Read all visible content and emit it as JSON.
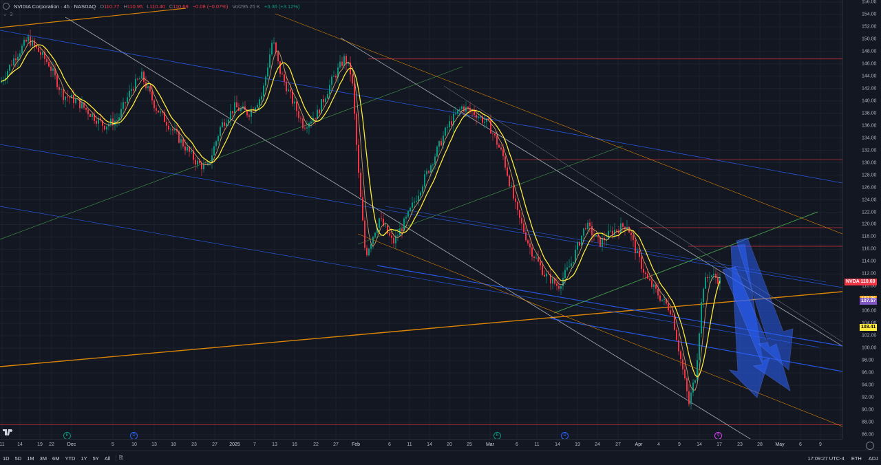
{
  "legend": {
    "symbol": "NVIDIA Corporation · 4h · NASDAQ",
    "o_label": "O",
    "o_val": "110.77",
    "h_label": "H",
    "h_val": "110.95",
    "l_label": "L",
    "l_val": "110.40",
    "c_label": "C",
    "c_val": "110.69",
    "change": "−0.08 (−0.07%)",
    "vol_label": "Vol",
    "vol_val": "295.25 K",
    "vol_change": "+3.36 (+3.12%)",
    "indicator_count": "3"
  },
  "price_axis": {
    "ticks": [
      "156.00",
      "154.00",
      "152.00",
      "150.00",
      "148.00",
      "146.00",
      "144.00",
      "142.00",
      "140.00",
      "138.00",
      "136.00",
      "134.00",
      "132.00",
      "130.00",
      "128.00",
      "126.00",
      "124.00",
      "122.00",
      "120.00",
      "118.00",
      "116.00",
      "114.00",
      "112.00",
      "110.00",
      "108.00",
      "106.00",
      "104.00",
      "102.00",
      "100.00",
      "98.00",
      "96.00",
      "94.00",
      "92.00",
      "90.00",
      "88.00",
      "86.00"
    ],
    "labels": [
      {
        "text": "NVDA",
        "value": "110.69",
        "bg": "#f23645",
        "fg": "#ffffff",
        "price": 110.69
      },
      {
        "text": "",
        "value": "107.96",
        "bg": "#ff9800",
        "fg": "#ffffff",
        "price": 107.96
      },
      {
        "text": "",
        "value": "107.57",
        "bg": "#7e57c2",
        "fg": "#ffffff",
        "price": 107.57
      },
      {
        "text": "",
        "value": "103.41",
        "bg": "#ffeb3b",
        "fg": "#000000",
        "price": 103.41
      }
    ]
  },
  "time_axis": {
    "ticks": [
      "11",
      "14",
      "19",
      "22",
      "Dec",
      "5",
      "10",
      "13",
      "18",
      "23",
      "27",
      "2025",
      "7",
      "13",
      "16",
      "22",
      "27",
      "Feb",
      "6",
      "11",
      "14",
      "20",
      "25",
      "Mar",
      "6",
      "11",
      "14",
      "19",
      "24",
      "27",
      "Apr",
      "4",
      "9",
      "14",
      "17",
      "23",
      "28",
      "May",
      "6",
      "9"
    ]
  },
  "bottom_bar": {
    "ranges": [
      "1D",
      "5D",
      "1M",
      "3M",
      "6M",
      "YTD",
      "1Y",
      "5Y",
      "All"
    ],
    "time": "17:09:27 UTC-4",
    "session": "ETH",
    "adj": "ADJ"
  },
  "events": [
    {
      "letter": "E",
      "kind": "earnings"
    },
    {
      "letter": "D",
      "kind": "dividend"
    },
    {
      "letter": "E",
      "kind": "earnings"
    },
    {
      "letter": "D",
      "kind": "dividend"
    }
  ],
  "colors": {
    "bg": "#131722",
    "up": "#089981",
    "down": "#f23645",
    "ma_fast": "#ffeb3b",
    "ma_slow": "#e3a86b",
    "trend_white": "#b2b5be",
    "trend_blue": "#2962ff",
    "trend_orange": "#ff9800",
    "trend_green": "#4caf50",
    "hline_red": "#f23645",
    "arrow_blue": "#2962ff"
  },
  "chart_data": {
    "type": "candlestick",
    "symbol": "NVDA",
    "interval": "4h",
    "ylim": [
      85,
      156
    ],
    "key_prices": [
      146.8,
      130.5,
      119.5,
      116.5,
      87.6
    ],
    "path": [
      [
        0,
        143
      ],
      [
        20,
        147
      ],
      [
        40,
        150
      ],
      [
        55,
        148
      ],
      [
        70,
        146
      ],
      [
        90,
        141
      ],
      [
        110,
        140
      ],
      [
        130,
        138
      ],
      [
        150,
        136
      ],
      [
        170,
        137
      ],
      [
        190,
        142
      ],
      [
        205,
        144
      ],
      [
        225,
        139
      ],
      [
        245,
        136
      ],
      [
        265,
        133
      ],
      [
        285,
        130
      ],
      [
        300,
        129
      ],
      [
        320,
        136
      ],
      [
        340,
        139
      ],
      [
        360,
        138
      ],
      [
        380,
        141
      ],
      [
        395,
        150
      ],
      [
        405,
        145
      ],
      [
        420,
        141
      ],
      [
        440,
        136
      ],
      [
        460,
        138
      ],
      [
        480,
        143
      ],
      [
        500,
        147
      ],
      [
        510,
        144
      ],
      [
        520,
        128
      ],
      [
        530,
        115
      ],
      [
        550,
        121
      ],
      [
        570,
        117
      ],
      [
        590,
        121
      ],
      [
        610,
        126
      ],
      [
        630,
        131
      ],
      [
        650,
        136
      ],
      [
        670,
        139
      ],
      [
        690,
        138
      ],
      [
        710,
        136
      ],
      [
        730,
        131
      ],
      [
        750,
        122
      ],
      [
        770,
        116
      ],
      [
        790,
        112
      ],
      [
        810,
        110
      ],
      [
        830,
        114
      ],
      [
        850,
        120
      ],
      [
        870,
        117
      ],
      [
        890,
        119
      ],
      [
        910,
        120
      ],
      [
        925,
        115
      ],
      [
        940,
        111
      ],
      [
        960,
        108
      ],
      [
        975,
        106
      ],
      [
        990,
        97
      ],
      [
        1000,
        91
      ],
      [
        1010,
        96
      ],
      [
        1020,
        110
      ],
      [
        1030,
        112
      ],
      [
        1045,
        111
      ]
    ]
  }
}
